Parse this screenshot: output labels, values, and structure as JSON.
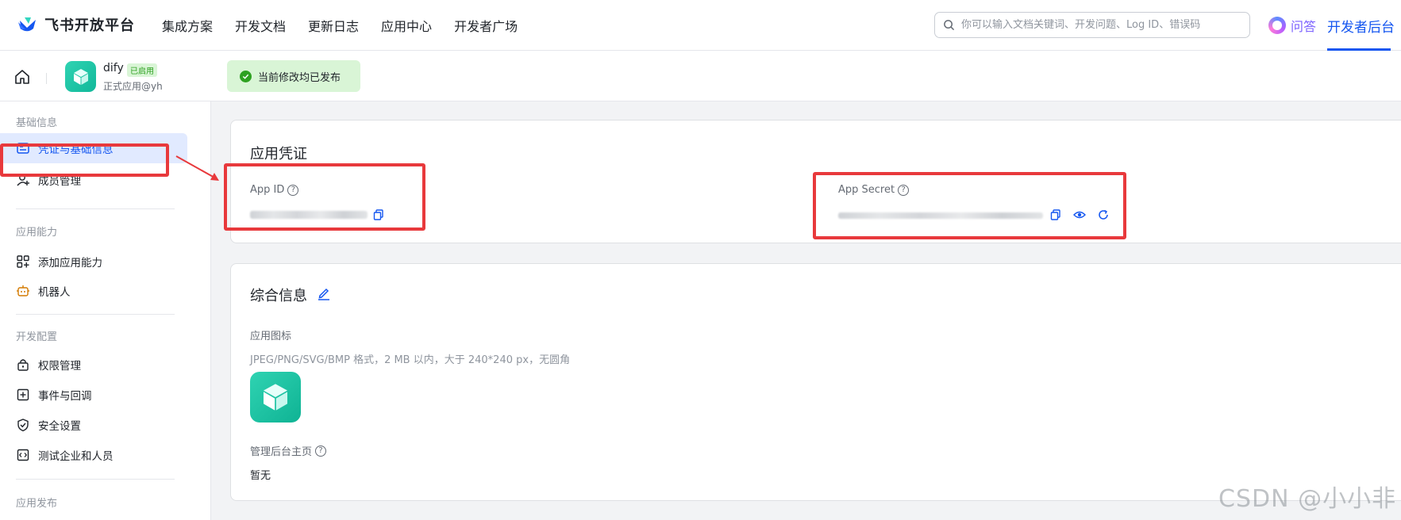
{
  "topnav": {
    "brand": "飞书开放平台",
    "menu": [
      "集成方案",
      "开发文档",
      "更新日志",
      "应用中心",
      "开发者广场"
    ],
    "search_placeholder": "你可以输入文档关键词、开发问题、Log ID、错误码",
    "ask_label": "问答",
    "console_label": "开发者后台",
    "accent": "#1456f0"
  },
  "subheader": {
    "app_name": "dify",
    "app_badge": "已启用",
    "app_sub": "正式应用@yh",
    "publish_status": "当前修改均已发布"
  },
  "sidebar": {
    "groups": [
      "基础信息",
      "应用能力",
      "开发配置",
      "应用发布"
    ],
    "items": [
      {
        "label": "凭证与基础信息",
        "icon": "id-card-icon",
        "active": true
      },
      {
        "label": "成员管理",
        "icon": "user-add-icon"
      },
      {
        "label": "添加应用能力",
        "icon": "grid-add-icon"
      },
      {
        "label": "机器人",
        "icon": "robot-icon"
      },
      {
        "label": "权限管理",
        "icon": "lock-icon"
      },
      {
        "label": "事件与回调",
        "icon": "event-icon"
      },
      {
        "label": "安全设置",
        "icon": "shield-icon"
      },
      {
        "label": "测试企业和人员",
        "icon": "code-icon"
      }
    ]
  },
  "credentials": {
    "title": "应用凭证",
    "app_id_label": "App ID",
    "app_secret_label": "App Secret"
  },
  "general": {
    "title": "综合信息",
    "icon_label": "应用图标",
    "icon_hint": "JPEG/PNG/SVG/BMP 格式，2 MB 以内，大于 240*240 px，无圆角",
    "homepage_label": "管理后台主页",
    "homepage_value": "暂无"
  },
  "watermark": "CSDN @小小非"
}
